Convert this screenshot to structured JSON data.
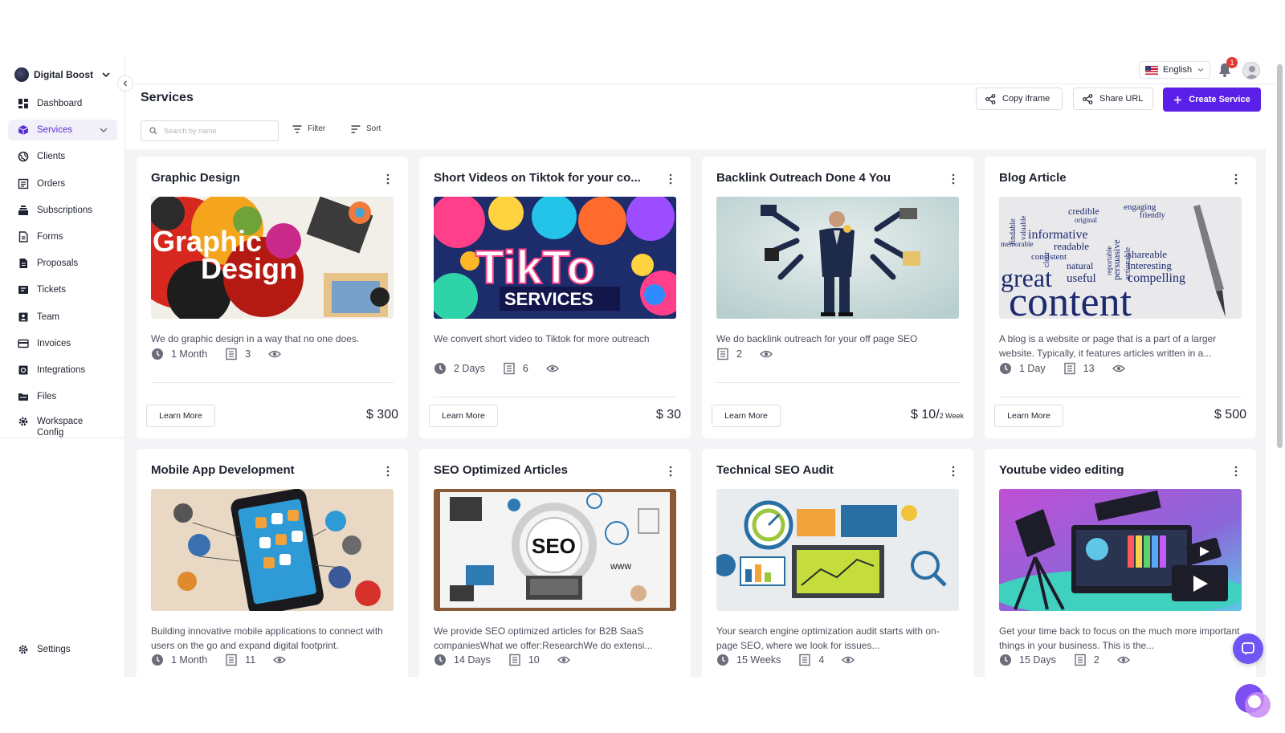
{
  "workspace": {
    "name": "Digital Boost"
  },
  "sidebar": {
    "items": [
      {
        "label": "Dashboard",
        "icon": "dashboard-icon"
      },
      {
        "label": "Services",
        "icon": "box-icon",
        "active": true
      },
      {
        "label": "Clients",
        "icon": "globe-icon"
      },
      {
        "label": "Orders",
        "icon": "orders-icon"
      },
      {
        "label": "Subscriptions",
        "icon": "stack-icon"
      },
      {
        "label": "Forms",
        "icon": "form-icon"
      },
      {
        "label": "Proposals",
        "icon": "proposal-icon"
      },
      {
        "label": "Tickets",
        "icon": "ticket-icon"
      },
      {
        "label": "Team",
        "icon": "team-icon"
      },
      {
        "label": "Invoices",
        "icon": "card-icon"
      },
      {
        "label": "Integrations",
        "icon": "integration-icon"
      },
      {
        "label": "Files",
        "icon": "folder-icon"
      },
      {
        "label": "Workspace\nConfig",
        "icon": "gear-icon"
      }
    ],
    "settings_label": "Settings"
  },
  "topbar": {
    "language": "English",
    "notification_count": "1"
  },
  "header": {
    "title": "Services",
    "copy_iframe_label": "Copy iframe",
    "share_url_label": "Share URL",
    "create_label": "Create Service"
  },
  "toolbar": {
    "search_placeholder": "Search by name",
    "filter_label": "Filter",
    "sort_label": "Sort"
  },
  "services": [
    {
      "title": "Graphic Design",
      "description": "We do graphic design in a way that no one does.",
      "duration": "1 Month",
      "count": "3",
      "price": "$ 300",
      "price_suffix": "",
      "learn_more": "Learn More"
    },
    {
      "title": "Short Videos on Tiktok for your co...",
      "description": "We convert short video to Tiktok for more outreach",
      "duration": "2 Days",
      "count": "6",
      "price": "$ 30",
      "price_suffix": "",
      "learn_more": "Learn More"
    },
    {
      "title": "Backlink Outreach Done 4 You",
      "description": "We do backlink outreach for your off page SEO",
      "duration": "",
      "count": "2",
      "price": "$ 10/",
      "price_suffix": "2 Week",
      "learn_more": "Learn More"
    },
    {
      "title": "Blog Article",
      "description": "A blog is a website or page that is a part of a larger website. Typically, it features articles written in a...",
      "duration": "1 Day",
      "count": "13",
      "price": "$ 500",
      "price_suffix": "",
      "learn_more": "Learn More"
    },
    {
      "title": "Mobile App Development",
      "description": "Building innovative mobile applications to connect with users on the go and expand digital footprint.",
      "duration": "1 Month",
      "count": "11"
    },
    {
      "title": "SEO Optimized Articles",
      "description": "We provide SEO optimized articles for B2B SaaS companiesWhat we offer:ResearchWe do extensi...",
      "duration": "14 Days",
      "count": "10"
    },
    {
      "title": "Technical SEO Audit",
      "description": "Your search engine optimization audit starts with on-page SEO, where we look for issues...",
      "duration": "15 Weeks",
      "count": "4"
    },
    {
      "title": "Youtube video editing",
      "description": "Get your time back to focus on the much more important things in your business.  This is the...",
      "duration": "15 Days",
      "count": "2"
    }
  ],
  "images": {
    "graphic_design_text_1": "Graphic",
    "graphic_design_text_2": "Design",
    "tiktok_text_1": "TikTo",
    "tiktok_text_2": "SERVICES",
    "seo_text": "SEO",
    "www_text": "www",
    "blog_words": [
      "engaging",
      "credible",
      "original",
      "friendly",
      "informative",
      "readable",
      "memorable",
      "consistent",
      "natural",
      "useful",
      "shareable",
      "interesting",
      "compelling",
      "great",
      "content",
      "findable",
      "valuable",
      "persuasive",
      "actionable",
      "clear",
      "reportable"
    ]
  },
  "colors": {
    "accent": "#5a1fe8",
    "active_nav_bg": "#f1eff8",
    "badge": "#e53935",
    "chat": "#6e56f5"
  }
}
